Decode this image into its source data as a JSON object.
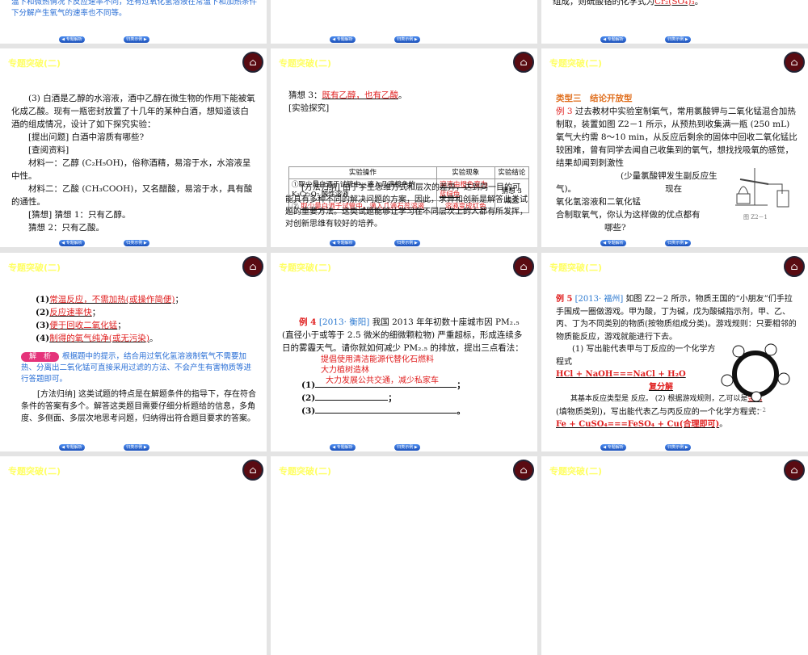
{
  "common": {
    "title": "专题突破(二)",
    "nav_prev": "◀ 专题解析",
    "nav_next": "归类示例 ▶"
  },
  "s0a": {
    "lines": [
      "温下和微热情况下反应速率不同，还有过氧化氢溶液在常温下和加热条件",
      "下分解产生氧气的速率也不同等。"
    ]
  },
  "s0c": {
    "text": "组成，则硫酸铬的化学式为",
    "answer": "Cr₂(SO₄)₃",
    "end": "。"
  },
  "s1a": {
    "lines": [
      "(3) 白酒是乙醇的水溶液，酒中乙醇在微生物的作用下能被氧化成乙酸。现有一瓶密封放置了十几年的某种白酒，想知道该白酒的组成情况，设计了如下探究实验：",
      "[提出问题] 白酒中溶质有哪些?",
      "[查阅资料]",
      "材料一：乙醇 (C₂H₅OH)，俗称酒精，易溶于水，水溶液呈中性。",
      "材料二：乙酸 (CH₃COOH)，又名醋酸，易溶于水，具有酸的通性。",
      "[猜想] 猜想 1：只有乙醇。",
      "猜想 2：只有乙酸。"
    ]
  },
  "s1b": {
    "guess_label": "猜想 3：",
    "guess_answer": "既有乙醇，也有乙酸",
    "period": "。",
    "explore": "[实验探究]",
    "headers": [
      "实验操作",
      "实验现象",
      "实验结论"
    ],
    "row1_op": "①取少量白酒于试管中，滴入几滴橙色的 K₂Cr₂O₇ 酸性溶液",
    "row1_ph": "溶液由橙色变为蓝绿色",
    "row2_num": "②",
    "row2_op": "取少量白酒于试管中，滴入几滴石蕊溶液",
    "row2_ph": "溶液变成红色",
    "conclusion": "猜想 3 成立",
    "method": "[方法归纳] 由于学生思维方式和层次的差异，达到同一目的可能具有多种不同的解决问题的方案，因此，求异和创新是解答此类试题的重要方法。这类试题能够让学习在不同层次上的人都有所发挥，对创新思维有较好的培养。"
  },
  "s1c": {
    "type": "类型三　结论开放型",
    "ex": "例 3",
    "text1": "过去教材中实验室制氧气，常用氯酸钾与二氧化锰混合加热制取，装置如图 Z2－1 所示，从预热到收集满一瓶 (250 mL) 氧气大约需 8～10 min，从反应后剩余的固体中回收二氧化锰比较困难，曾有同学去闻自己收集到的氧气，想找找吸氧的感觉，结果却闻到刺激性",
    "text2": "(少量氯酸钾发生副反应生",
    "text3": "气)。",
    "text4": "现在",
    "text5": "氧化氢溶液和二氧化锰",
    "text6": "合制取氧气，你认为这样做的优点都有",
    "text7": "哪些?",
    "fig": "图 Z2－1"
  },
  "s2a": {
    "items": [
      {
        "n": "(1)",
        "a": "常温反应，不需加热(或操作简便)",
        "e": "；"
      },
      {
        "n": "(2)",
        "a": "反应速率快",
        "e": "；"
      },
      {
        "n": "(3)",
        "a": "便于回收二氧化锰",
        "e": "；"
      },
      {
        "n": "(4)",
        "a": "制得的氧气纯净(或无污染)",
        "e": "。"
      }
    ],
    "badge": "解　析",
    "analysis": "根据题中的提示，结合用过氧化氢溶液制氧气不需要加热、分离出二氧化锰可直接采用过滤的方法、不会产生有害物质等进行答题即可。",
    "method": "[方法归纳] 这类试题的特点是在解题条件的指导下，存在符合条件的答案有多个。解答这类题目需要仔细分析题给的信息，多角度、多侧面、多层次地思考问题，归纳得出符合题目要求的答案。"
  },
  "s2b": {
    "ex": "例 4",
    "src": "[2013· 衡阳]",
    "text": "我国 2013 年年初数十座城市因 PM₂.₅ (直径小于或等于 2.5 微米的细微颗粒物) 严重超标，形成连续多日的雾霾天气。请你就如何减少 PM₂.₅ 的排放，提出三点看法：",
    "a1": "提倡使用清洁能源代替化石燃料",
    "a2": "大力植树造林",
    "a3": "大力发展公共交通，减少私家车",
    "n1": "(1)",
    "n2": "(2)",
    "n3": "(3)",
    "e1": "；",
    "e2": "；",
    "e3": "。"
  },
  "s2c": {
    "ex": "例 5",
    "src": "[2013· 福州]",
    "text": "如图 Z2－2 所示，物质王国的“小朋友”们手拉手围成一圈做游戏。甲为酸，丁为碱，戊为酸碱指示剂，甲、乙、丙、丁为不同类别的物质(按物质组成分类)。游戏规则：只要相邻的物质能反应，游戏就能进行下去。",
    "q1": "(1) 写出能代表甲与丁反应的一个化学方程式",
    "eq1": "HCl + NaOH===NaCl + H₂O",
    "type1": "复分解",
    "q2a": "其基本反应类型是",
    "q2b": "反应。",
    "q2": "(2) 根据游戏规则，乙可以是",
    "a2": "金属",
    "q2c": "(填物质类别)，写出能代表乙与丙反应的一个化学方程式：",
    "eq2": "Fe + CuSO₄===FeSO₄ + Cu(合理即可)",
    "end": "。",
    "fig": "图 Z2－2"
  }
}
